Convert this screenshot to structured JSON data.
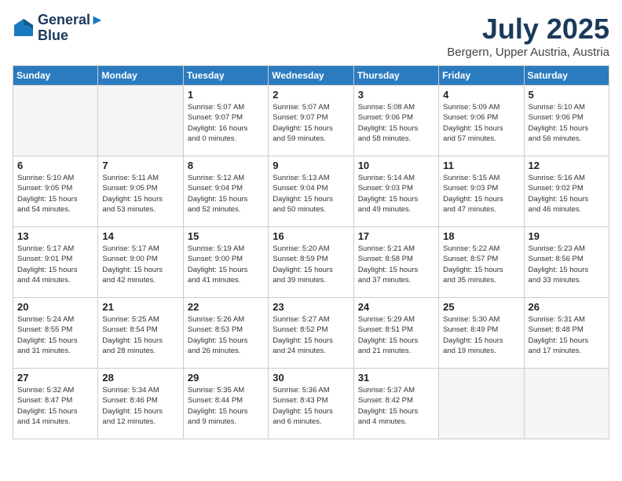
{
  "header": {
    "logo_line1": "General",
    "logo_line2": "Blue",
    "month": "July 2025",
    "location": "Bergern, Upper Austria, Austria"
  },
  "weekdays": [
    "Sunday",
    "Monday",
    "Tuesday",
    "Wednesday",
    "Thursday",
    "Friday",
    "Saturday"
  ],
  "weeks": [
    [
      {
        "day": "",
        "detail": ""
      },
      {
        "day": "",
        "detail": ""
      },
      {
        "day": "1",
        "detail": "Sunrise: 5:07 AM\nSunset: 9:07 PM\nDaylight: 16 hours\nand 0 minutes."
      },
      {
        "day": "2",
        "detail": "Sunrise: 5:07 AM\nSunset: 9:07 PM\nDaylight: 15 hours\nand 59 minutes."
      },
      {
        "day": "3",
        "detail": "Sunrise: 5:08 AM\nSunset: 9:06 PM\nDaylight: 15 hours\nand 58 minutes."
      },
      {
        "day": "4",
        "detail": "Sunrise: 5:09 AM\nSunset: 9:06 PM\nDaylight: 15 hours\nand 57 minutes."
      },
      {
        "day": "5",
        "detail": "Sunrise: 5:10 AM\nSunset: 9:06 PM\nDaylight: 15 hours\nand 56 minutes."
      }
    ],
    [
      {
        "day": "6",
        "detail": "Sunrise: 5:10 AM\nSunset: 9:05 PM\nDaylight: 15 hours\nand 54 minutes."
      },
      {
        "day": "7",
        "detail": "Sunrise: 5:11 AM\nSunset: 9:05 PM\nDaylight: 15 hours\nand 53 minutes."
      },
      {
        "day": "8",
        "detail": "Sunrise: 5:12 AM\nSunset: 9:04 PM\nDaylight: 15 hours\nand 52 minutes."
      },
      {
        "day": "9",
        "detail": "Sunrise: 5:13 AM\nSunset: 9:04 PM\nDaylight: 15 hours\nand 50 minutes."
      },
      {
        "day": "10",
        "detail": "Sunrise: 5:14 AM\nSunset: 9:03 PM\nDaylight: 15 hours\nand 49 minutes."
      },
      {
        "day": "11",
        "detail": "Sunrise: 5:15 AM\nSunset: 9:03 PM\nDaylight: 15 hours\nand 47 minutes."
      },
      {
        "day": "12",
        "detail": "Sunrise: 5:16 AM\nSunset: 9:02 PM\nDaylight: 15 hours\nand 46 minutes."
      }
    ],
    [
      {
        "day": "13",
        "detail": "Sunrise: 5:17 AM\nSunset: 9:01 PM\nDaylight: 15 hours\nand 44 minutes."
      },
      {
        "day": "14",
        "detail": "Sunrise: 5:17 AM\nSunset: 9:00 PM\nDaylight: 15 hours\nand 42 minutes."
      },
      {
        "day": "15",
        "detail": "Sunrise: 5:19 AM\nSunset: 9:00 PM\nDaylight: 15 hours\nand 41 minutes."
      },
      {
        "day": "16",
        "detail": "Sunrise: 5:20 AM\nSunset: 8:59 PM\nDaylight: 15 hours\nand 39 minutes."
      },
      {
        "day": "17",
        "detail": "Sunrise: 5:21 AM\nSunset: 8:58 PM\nDaylight: 15 hours\nand 37 minutes."
      },
      {
        "day": "18",
        "detail": "Sunrise: 5:22 AM\nSunset: 8:57 PM\nDaylight: 15 hours\nand 35 minutes."
      },
      {
        "day": "19",
        "detail": "Sunrise: 5:23 AM\nSunset: 8:56 PM\nDaylight: 15 hours\nand 33 minutes."
      }
    ],
    [
      {
        "day": "20",
        "detail": "Sunrise: 5:24 AM\nSunset: 8:55 PM\nDaylight: 15 hours\nand 31 minutes."
      },
      {
        "day": "21",
        "detail": "Sunrise: 5:25 AM\nSunset: 8:54 PM\nDaylight: 15 hours\nand 28 minutes."
      },
      {
        "day": "22",
        "detail": "Sunrise: 5:26 AM\nSunset: 8:53 PM\nDaylight: 15 hours\nand 26 minutes."
      },
      {
        "day": "23",
        "detail": "Sunrise: 5:27 AM\nSunset: 8:52 PM\nDaylight: 15 hours\nand 24 minutes."
      },
      {
        "day": "24",
        "detail": "Sunrise: 5:29 AM\nSunset: 8:51 PM\nDaylight: 15 hours\nand 21 minutes."
      },
      {
        "day": "25",
        "detail": "Sunrise: 5:30 AM\nSunset: 8:49 PM\nDaylight: 15 hours\nand 19 minutes."
      },
      {
        "day": "26",
        "detail": "Sunrise: 5:31 AM\nSunset: 8:48 PM\nDaylight: 15 hours\nand 17 minutes."
      }
    ],
    [
      {
        "day": "27",
        "detail": "Sunrise: 5:32 AM\nSunset: 8:47 PM\nDaylight: 15 hours\nand 14 minutes."
      },
      {
        "day": "28",
        "detail": "Sunrise: 5:34 AM\nSunset: 8:46 PM\nDaylight: 15 hours\nand 12 minutes."
      },
      {
        "day": "29",
        "detail": "Sunrise: 5:35 AM\nSunset: 8:44 PM\nDaylight: 15 hours\nand 9 minutes."
      },
      {
        "day": "30",
        "detail": "Sunrise: 5:36 AM\nSunset: 8:43 PM\nDaylight: 15 hours\nand 6 minutes."
      },
      {
        "day": "31",
        "detail": "Sunrise: 5:37 AM\nSunset: 8:42 PM\nDaylight: 15 hours\nand 4 minutes."
      },
      {
        "day": "",
        "detail": ""
      },
      {
        "day": "",
        "detail": ""
      }
    ]
  ]
}
